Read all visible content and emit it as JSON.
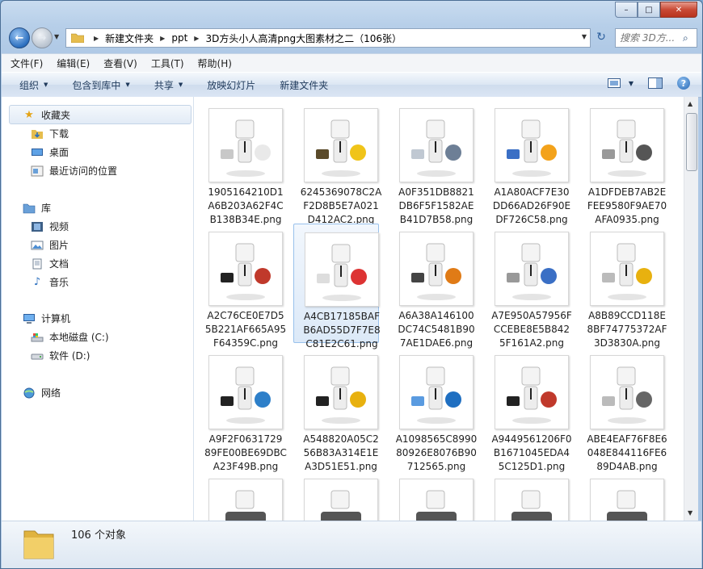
{
  "window": {
    "caption": {
      "min": "–",
      "max": "□",
      "close": "✕"
    }
  },
  "address": {
    "crumbs": [
      "新建文件夹",
      "ppt",
      "3D方头小人高清png大图素材之二（106张）"
    ],
    "search_placeholder": "搜索 3D方..."
  },
  "menu": [
    "文件(F)",
    "编辑(E)",
    "查看(V)",
    "工具(T)",
    "帮助(H)"
  ],
  "toolbar": {
    "organize": "组织",
    "include": "包含到库中",
    "share": "共享",
    "slideshow": "放映幻灯片",
    "new_folder": "新建文件夹"
  },
  "nav": {
    "favorites": "收藏夹",
    "favorites_items": [
      "下载",
      "桌面",
      "最近访问的位置"
    ],
    "libraries": "库",
    "libraries_items": [
      "视频",
      "图片",
      "文档",
      "音乐"
    ],
    "computer": "计算机",
    "computer_items": [
      "本地磁盘 (C:)",
      "软件 (D:)"
    ],
    "network": "网络"
  },
  "files": [
    "1905164210D1A6B203A62F4CB138B34E.png",
    "6245369078C2AF2D8B5E7A021D412AC2.png",
    "A0F351DB8821DB6F5F1582AEB41D7B58.png",
    "A1A80ACF7E30DD66AD26F90EDF726C58.png",
    "A1DFDEB7AB2EFEE9580F9AE70AFA0935.png",
    "A2C76CE0E7D55B221AF665A95F64359C.png",
    "A4CB17185BAFB6AD55D7F7E8C81E2C61.png",
    "A6A38A146100DC74C5481B907AE1DAE6.png",
    "A7E950A57956FCCEBE8E5B8425F161A2.png",
    "A8B89CCD118E8BF74775372AF3D3830A.png",
    "A9F2F063172989FE00BE69DBCA23F49B.png",
    "A548820A05C256B83A314E1EA3D51E51.png",
    "A1098565C899080926E8076B90712565.png",
    "A9449561206F0B1671045EDA45C125D1.png",
    "ABE4EAF76F8E6048E844116FE689D4AB.png"
  ],
  "file_names_wrapped": [
    [
      "1905164210D1",
      "A6B203A62F4C",
      "B138B34E.png"
    ],
    [
      "6245369078C2A",
      "F2D8B5E7A021",
      "D412AC2.png"
    ],
    [
      "A0F351DB8821",
      "DB6F5F1582AE",
      "B41D7B58.png"
    ],
    [
      "A1A80ACF7E30",
      "DD66AD26F90E",
      "DF726C58.png"
    ],
    [
      "A1DFDEB7AB2E",
      "FEE9580F9AE70",
      "AFA0935.png"
    ],
    [
      "A2C76CE0E7D5",
      "5B221AF665A95",
      "F64359C.png"
    ],
    [
      "A4CB17185BAF",
      "B6AD55D7F7E8",
      "C81E2C61.png"
    ],
    [
      "A6A38A146100",
      "DC74C5481B90",
      "7AE1DAE6.png"
    ],
    [
      "A7E950A57956F",
      "CCEBE8E5B842",
      "5F161A2.png"
    ],
    [
      "A8B89CCD118E",
      "8BF74775372AF",
      "3D3830A.png"
    ],
    [
      "A9F2F0631729",
      "89FE00BE69DBC",
      "A23F49B.png"
    ],
    [
      "A548820A05C2",
      "56B83A314E1E",
      "A3D51E51.png"
    ],
    [
      "A1098565C8990",
      "80926E8076B90",
      "712565.png"
    ],
    [
      "A9449561206F0",
      "B1671045EDA4",
      "5C125D1.png"
    ],
    [
      "ABE4EAF76F8E6",
      "048E844116FE6",
      "89D4AB.png"
    ]
  ],
  "selected_index": 6,
  "status": {
    "count": "106 个对象"
  },
  "colors": {
    "selection": "#cce4f7",
    "accent": "#2b6fbf"
  }
}
